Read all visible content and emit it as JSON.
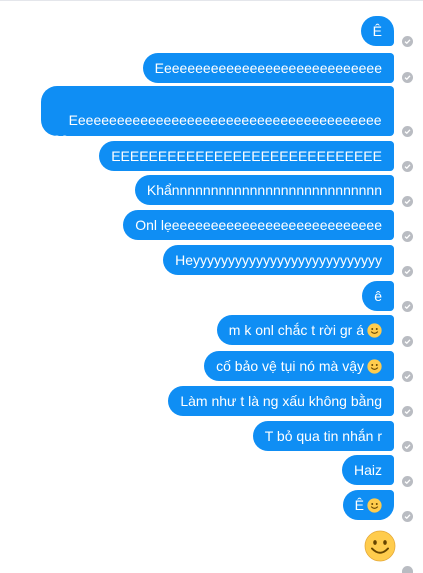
{
  "colors": {
    "bubble": "#0f8ef4",
    "bubble_text": "#ffffff",
    "status_icon": "#b9bcc2",
    "emoji_face": "#ffcc4d"
  },
  "messages": [
    {
      "text": "Ê",
      "emoji": false
    },
    {
      "text": "Eeeeeeeeeeeeeeeeeeeeeeeeeeeee",
      "emoji": false
    },
    {
      "text": "Eeeeeeeeeeeeeeeeeeeeeeeeeeeeeeeeeeeeeeeeee\neeeeee",
      "emoji": false
    },
    {
      "text": "EEEEEEEEEEEEEEEEEEEEEEEEEEEEE",
      "emoji": false
    },
    {
      "text": "Khẩnnnnnnnnnnnnnnnnnnnnnnnnnnn",
      "emoji": false
    },
    {
      "text": "Onl lẹeeeeeeeeeeeeeeeeeeeeeeeeeee",
      "emoji": false
    },
    {
      "text": "Heyyyyyyyyyyyyyyyyyyyyyyyyyyy",
      "emoji": false
    },
    {
      "text": "ê",
      "emoji": false
    },
    {
      "text": "m k onl chắc t rời gr á",
      "emoji": true
    },
    {
      "text": "cố bảo vệ tụi nó mà vậy",
      "emoji": true
    },
    {
      "text": "Làm như t là ng xấu không bằng",
      "emoji": false
    },
    {
      "text": "T bỏ qua tin nhắn r",
      "emoji": false
    },
    {
      "text": "Haiz",
      "emoji": false
    },
    {
      "text": "Ê",
      "emoji": true
    }
  ],
  "final_emoji": "smiling-face-emoji",
  "icons": {
    "status": "check-circle-icon",
    "emoji": "smiling-face-emoji"
  }
}
